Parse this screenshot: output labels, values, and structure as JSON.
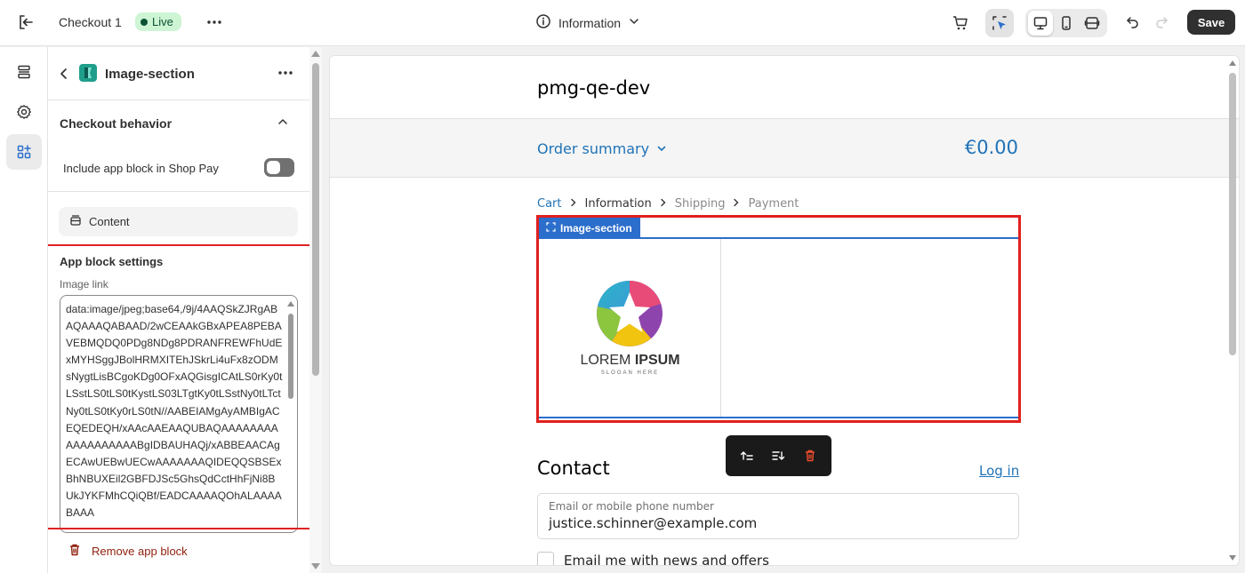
{
  "topbar": {
    "title": "Checkout 1",
    "status_badge": "Live",
    "page_selector": "Information",
    "save_label": "Save"
  },
  "panel": {
    "header_title": "Image-section",
    "section_title": "Checkout behavior",
    "toggle_label": "Include app block in Shop Pay",
    "toggle_on": false,
    "content_label": "Content",
    "settings_title": "App block settings",
    "image_link_label": "Image link",
    "image_link_value": "data:image/jpeg;base64,/9j/4AAQSkZJRgABAQAAAQABAAD/2wCEAAkGBxAPEA8PEBAVEBMQDQ0PDg8NDg8PDRANFREWFhUdExMYHSggJBolHRMXITEhJSkrLi4uFx8zODMsNygtLisBCgoKDg0OFxAQGisgICAtLS0rKy0tLSstLS0tLS0tKystLS03LTgtKy0tLSstNy0tLTctNy0tLS0tKy0rLS0tN//AABEIAMgAyAMBIgACEQEDEQH/xAAcAAEAAQUBAQAAAAAAAAAAAAAAAAAABgIDBAUHAQj/xABBEAACAgECAwUEBwUECwAAAAAAAQIDEQQSBSExBhNBUXEil2GBFDJSc5GhsQdCctHhFjNi8BUkJYKFMhCQiQBf/EADCAAAAQOhALAAAABAAA",
    "remove_label": "Remove app block"
  },
  "preview": {
    "store_name": "pmg-qe-dev",
    "order_summary_label": "Order summary",
    "order_total": "€0.00",
    "breadcrumb": {
      "cart": "Cart",
      "information": "Information",
      "shipping": "Shipping",
      "payment": "Payment"
    },
    "image_section_tag": "Image-section",
    "logo_word_light": "LOREM",
    "logo_word_bold": "IPSUM",
    "logo_slogan": "SLOGAN HERE",
    "contact_title": "Contact",
    "login_link": "Log in",
    "email_label": "Email or mobile phone number",
    "email_value": "justice.schinner@example.com",
    "news_label": "Email me with news and offers"
  },
  "colors": {
    "accent_blue": "#2c6ecb",
    "link_blue": "#1f73b7",
    "highlight_red": "#e02020",
    "live_green": "#cdf5d4",
    "danger": "#8e1f0b"
  },
  "icons": [
    "exit-icon",
    "more-icon",
    "info-icon",
    "chevron-down-icon",
    "cart-icon",
    "select-icon",
    "desktop-icon",
    "mobile-icon",
    "fullwidth-icon",
    "undo-icon",
    "redo-icon",
    "sections-icon",
    "settings-icon",
    "apps-icon",
    "back-icon",
    "chevron-up-icon",
    "content-icon",
    "trash-icon",
    "move-up-icon",
    "move-down-icon",
    "delete-icon"
  ]
}
